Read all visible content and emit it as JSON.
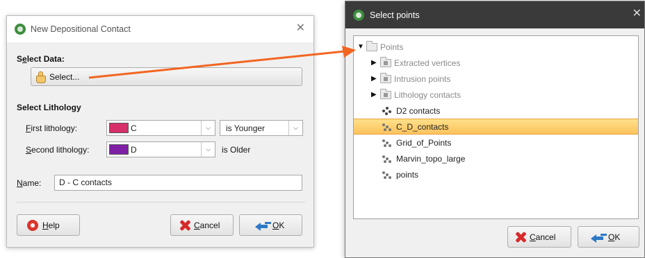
{
  "left_dialog": {
    "title": "New Depositional Contact",
    "select_data": {
      "heading_pre": "S",
      "heading_u": "e",
      "heading_post": "lect Data:",
      "select_button_label": "Select..."
    },
    "select_lithology": {
      "heading": "Select Lithology",
      "first_label_u": "F",
      "first_label_rest": "irst lithology:",
      "first_value": "C",
      "first_color": "#d62f6a",
      "relation_value": "is Younger",
      "second_label_u": "S",
      "second_label_rest": "econd lithology:",
      "second_value": "D",
      "second_color": "#7e1fa6",
      "second_relation": "is Older"
    },
    "name": {
      "label_u": "N",
      "label_rest": "ame:",
      "value": "D - C contacts"
    },
    "buttons": {
      "help_u": "H",
      "help_rest": "elp",
      "cancel_u": "C",
      "cancel_rest": "ancel",
      "ok_u": "O",
      "ok_rest": "K"
    }
  },
  "right_dialog": {
    "title": "Select points",
    "tree": {
      "root": "Points",
      "folders": [
        "Extracted vertices",
        "Intrusion points",
        "Lithology contacts"
      ],
      "items": [
        "D2 contacts",
        "C_D_contacts",
        "Grid_of_Points",
        "Marvin_topo_large",
        "points"
      ],
      "selected_item": "C_D_contacts"
    },
    "buttons": {
      "cancel_u": "C",
      "cancel_rest": "ancel",
      "ok_u": "O",
      "ok_rest": "K"
    }
  },
  "annotation_arrow_color": "#f26522",
  "selection_color": "#fcc25c"
}
